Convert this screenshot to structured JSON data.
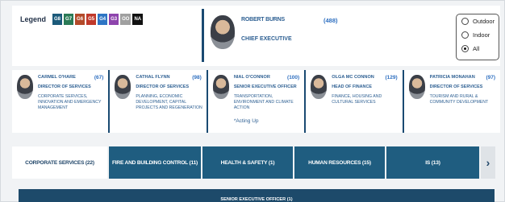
{
  "legend": {
    "title": "Legend",
    "items": [
      {
        "label": "G8",
        "color": "#1c5a7a"
      },
      {
        "label": "G7",
        "color": "#2a7a56"
      },
      {
        "label": "G6",
        "color": "#b34a2a"
      },
      {
        "label": "G5",
        "color": "#c0392b"
      },
      {
        "label": "G4",
        "color": "#2e75c4"
      },
      {
        "label": "G3",
        "color": "#8e44ad"
      },
      {
        "label": "OO",
        "color": "#a0a0a0"
      },
      {
        "label": "NA",
        "color": "#111111"
      }
    ]
  },
  "ceo": {
    "name": "ROBERT BURNS",
    "count": "(488)",
    "title": "CHIEF EXECUTIVE"
  },
  "filter": {
    "options": [
      {
        "label": "Outdoor",
        "selected": false
      },
      {
        "label": "Indoor",
        "selected": false
      },
      {
        "label": "All",
        "selected": true
      }
    ]
  },
  "directors": [
    {
      "name": "CARMEL O'HARE",
      "count": "(67)",
      "role": "DIRECTOR OF SERVICES",
      "area": "CORPORATE SERVICES, INNOVATION AND EMERGENCY MANAGEMENT",
      "note": ""
    },
    {
      "name": "CATHAL FLYNN",
      "count": "(98)",
      "role": "DIRECTOR OF SERVICES",
      "area": "PLANNING, ECONOMIC DEVELOPMENT, CAPITAL PROJECTS AND REGENERATION",
      "note": ""
    },
    {
      "name": "NIAL O'CONNOR",
      "count": "(100)",
      "role": "SENIOR EXECUTIVE OFFICER",
      "area": "TRANSPORTATION, ENVIRONMENT AND CLIMATE ACTION",
      "note": "*Acting Up"
    },
    {
      "name": "OLGA MC CONNON",
      "count": "(129)",
      "role": "HEAD OF FINANCE",
      "area": "FINANCE, HOUSING AND CULTURAL SERVICES",
      "note": ""
    },
    {
      "name": "PATRICIA MONAHAN",
      "count": "(97)",
      "role": "DIRECTOR OF SERVICES",
      "area": "TOURISM AND RURAL & COMMUNITY DEVELOPMENT",
      "note": ""
    }
  ],
  "tabs": [
    {
      "label": "CORPORATE SERVICES (22)",
      "active": true
    },
    {
      "label": "FIRE AND BUILDING CONTROL (11)",
      "active": false
    },
    {
      "label": "HEALTH & SAFETY (1)",
      "active": false
    },
    {
      "label": "HUMAN RESOURCES (15)",
      "active": false
    },
    {
      "label": "IS (13)",
      "active": false
    }
  ],
  "tab_next": "›",
  "section_bar": "SENIOR EXECUTIVE OFFICER (1)"
}
